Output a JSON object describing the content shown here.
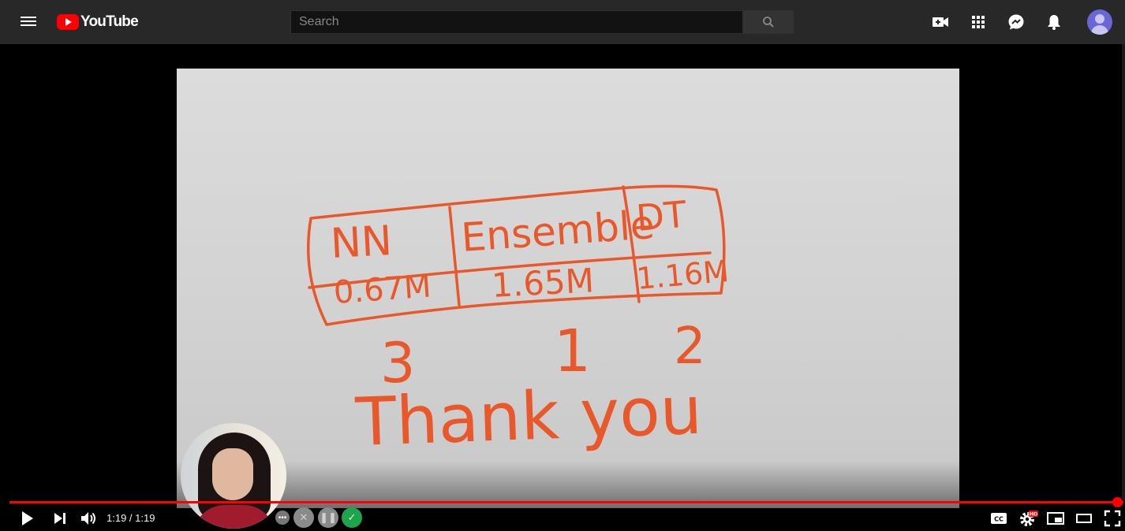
{
  "header": {
    "logo_text": "YouTube",
    "search_placeholder": "Search",
    "icons": [
      "menu-icon",
      "youtube-logo",
      "search-icon",
      "create-video-icon",
      "apps-grid-icon",
      "messages-icon",
      "notifications-bell-icon",
      "account-avatar"
    ]
  },
  "video": {
    "whiteboard": {
      "table_headers": [
        "NN",
        "Ensemble",
        "DT"
      ],
      "table_values": [
        "0.67M",
        "1.65M",
        "1.16M"
      ],
      "ranks": [
        "3",
        "1",
        "2"
      ],
      "closing": "Thank you"
    }
  },
  "player": {
    "time_display": "1:19 / 1:19",
    "progress": 1.0,
    "progress_color": "#ff0000",
    "hd_badge": "HD",
    "controls": [
      "play-icon",
      "next-icon",
      "volume-icon",
      "captions-icon",
      "settings-icon",
      "miniplayer-icon",
      "theater-mode-icon",
      "fullscreen-icon"
    ]
  },
  "recorder": {
    "buttons": [
      "more",
      "close",
      "pause",
      "done"
    ],
    "close_glyph": "✕",
    "pause_glyph": "❚❚",
    "done_glyph": "✓",
    "more_glyph": "•••"
  },
  "colors": {
    "header_bg": "#282828",
    "brand_red": "#ff0000",
    "marker_orange": "#e8582a"
  }
}
